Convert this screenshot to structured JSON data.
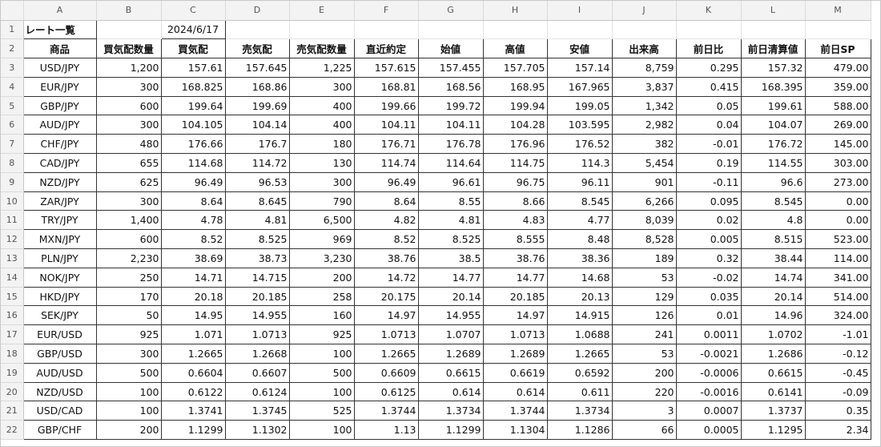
{
  "columns": [
    "A",
    "B",
    "C",
    "D",
    "E",
    "F",
    "G",
    "H",
    "I",
    "J",
    "K",
    "L",
    "M"
  ],
  "row1": {
    "title": "レート一覧",
    "date": "2024/6/17"
  },
  "headers": [
    "商品",
    "買気配数量",
    "買気配",
    "売気配",
    "売気配数量",
    "直近約定",
    "始値",
    "高値",
    "安値",
    "出来高",
    "前日比",
    "前日清算値",
    "前日SP"
  ],
  "rows": [
    [
      "USD/JPY",
      "1,200",
      "157.61",
      "157.645",
      "1,225",
      "157.615",
      "157.455",
      "157.705",
      "157.14",
      "8,759",
      "0.295",
      "157.32",
      "479.00"
    ],
    [
      "EUR/JPY",
      "300",
      "168.825",
      "168.86",
      "300",
      "168.81",
      "168.56",
      "168.95",
      "167.965",
      "3,837",
      "0.415",
      "168.395",
      "359.00"
    ],
    [
      "GBP/JPY",
      "600",
      "199.64",
      "199.69",
      "400",
      "199.66",
      "199.72",
      "199.94",
      "199.05",
      "1,342",
      "0.05",
      "199.61",
      "588.00"
    ],
    [
      "AUD/JPY",
      "300",
      "104.105",
      "104.14",
      "400",
      "104.11",
      "104.11",
      "104.28",
      "103.595",
      "2,982",
      "0.04",
      "104.07",
      "269.00"
    ],
    [
      "CHF/JPY",
      "480",
      "176.66",
      "176.7",
      "180",
      "176.71",
      "176.78",
      "176.96",
      "176.52",
      "382",
      "-0.01",
      "176.72",
      "145.00"
    ],
    [
      "CAD/JPY",
      "655",
      "114.68",
      "114.72",
      "130",
      "114.74",
      "114.64",
      "114.75",
      "114.3",
      "5,454",
      "0.19",
      "114.55",
      "303.00"
    ],
    [
      "NZD/JPY",
      "625",
      "96.49",
      "96.53",
      "300",
      "96.49",
      "96.61",
      "96.75",
      "96.11",
      "901",
      "-0.11",
      "96.6",
      "273.00"
    ],
    [
      "ZAR/JPY",
      "300",
      "8.64",
      "8.645",
      "790",
      "8.64",
      "8.55",
      "8.66",
      "8.545",
      "6,266",
      "0.095",
      "8.545",
      "0.00"
    ],
    [
      "TRY/JPY",
      "1,400",
      "4.78",
      "4.81",
      "6,500",
      "4.82",
      "4.81",
      "4.83",
      "4.77",
      "8,039",
      "0.02",
      "4.8",
      "0.00"
    ],
    [
      "MXN/JPY",
      "600",
      "8.52",
      "8.525",
      "969",
      "8.52",
      "8.525",
      "8.555",
      "8.48",
      "8,528",
      "0.005",
      "8.515",
      "523.00"
    ],
    [
      "PLN/JPY",
      "2,230",
      "38.69",
      "38.73",
      "3,230",
      "38.76",
      "38.5",
      "38.76",
      "38.36",
      "189",
      "0.32",
      "38.44",
      "114.00"
    ],
    [
      "NOK/JPY",
      "250",
      "14.71",
      "14.715",
      "200",
      "14.72",
      "14.77",
      "14.77",
      "14.68",
      "53",
      "-0.02",
      "14.74",
      "341.00"
    ],
    [
      "HKD/JPY",
      "170",
      "20.18",
      "20.185",
      "258",
      "20.175",
      "20.14",
      "20.185",
      "20.13",
      "129",
      "0.035",
      "20.14",
      "514.00"
    ],
    [
      "SEK/JPY",
      "50",
      "14.95",
      "14.955",
      "160",
      "14.97",
      "14.955",
      "14.97",
      "14.915",
      "126",
      "0.01",
      "14.96",
      "324.00"
    ],
    [
      "EUR/USD",
      "925",
      "1.071",
      "1.0713",
      "925",
      "1.0713",
      "1.0707",
      "1.0713",
      "1.0688",
      "241",
      "0.0011",
      "1.0702",
      "-1.01"
    ],
    [
      "GBP/USD",
      "300",
      "1.2665",
      "1.2668",
      "100",
      "1.2665",
      "1.2689",
      "1.2689",
      "1.2665",
      "53",
      "-0.0021",
      "1.2686",
      "-0.12"
    ],
    [
      "AUD/USD",
      "500",
      "0.6604",
      "0.6607",
      "500",
      "0.6609",
      "0.6615",
      "0.6619",
      "0.6592",
      "200",
      "-0.0006",
      "0.6615",
      "-0.45"
    ],
    [
      "NZD/USD",
      "100",
      "0.6122",
      "0.6124",
      "100",
      "0.6125",
      "0.614",
      "0.614",
      "0.611",
      "220",
      "-0.0016",
      "0.6141",
      "-0.09"
    ],
    [
      "USD/CAD",
      "100",
      "1.3741",
      "1.3745",
      "525",
      "1.3744",
      "1.3734",
      "1.3744",
      "1.3734",
      "3",
      "0.0007",
      "1.3737",
      "0.35"
    ],
    [
      "GBP/CHF",
      "200",
      "1.1299",
      "1.1302",
      "100",
      "1.13",
      "1.1299",
      "1.1304",
      "1.1286",
      "66",
      "0.0005",
      "1.1295",
      "2.34"
    ]
  ]
}
